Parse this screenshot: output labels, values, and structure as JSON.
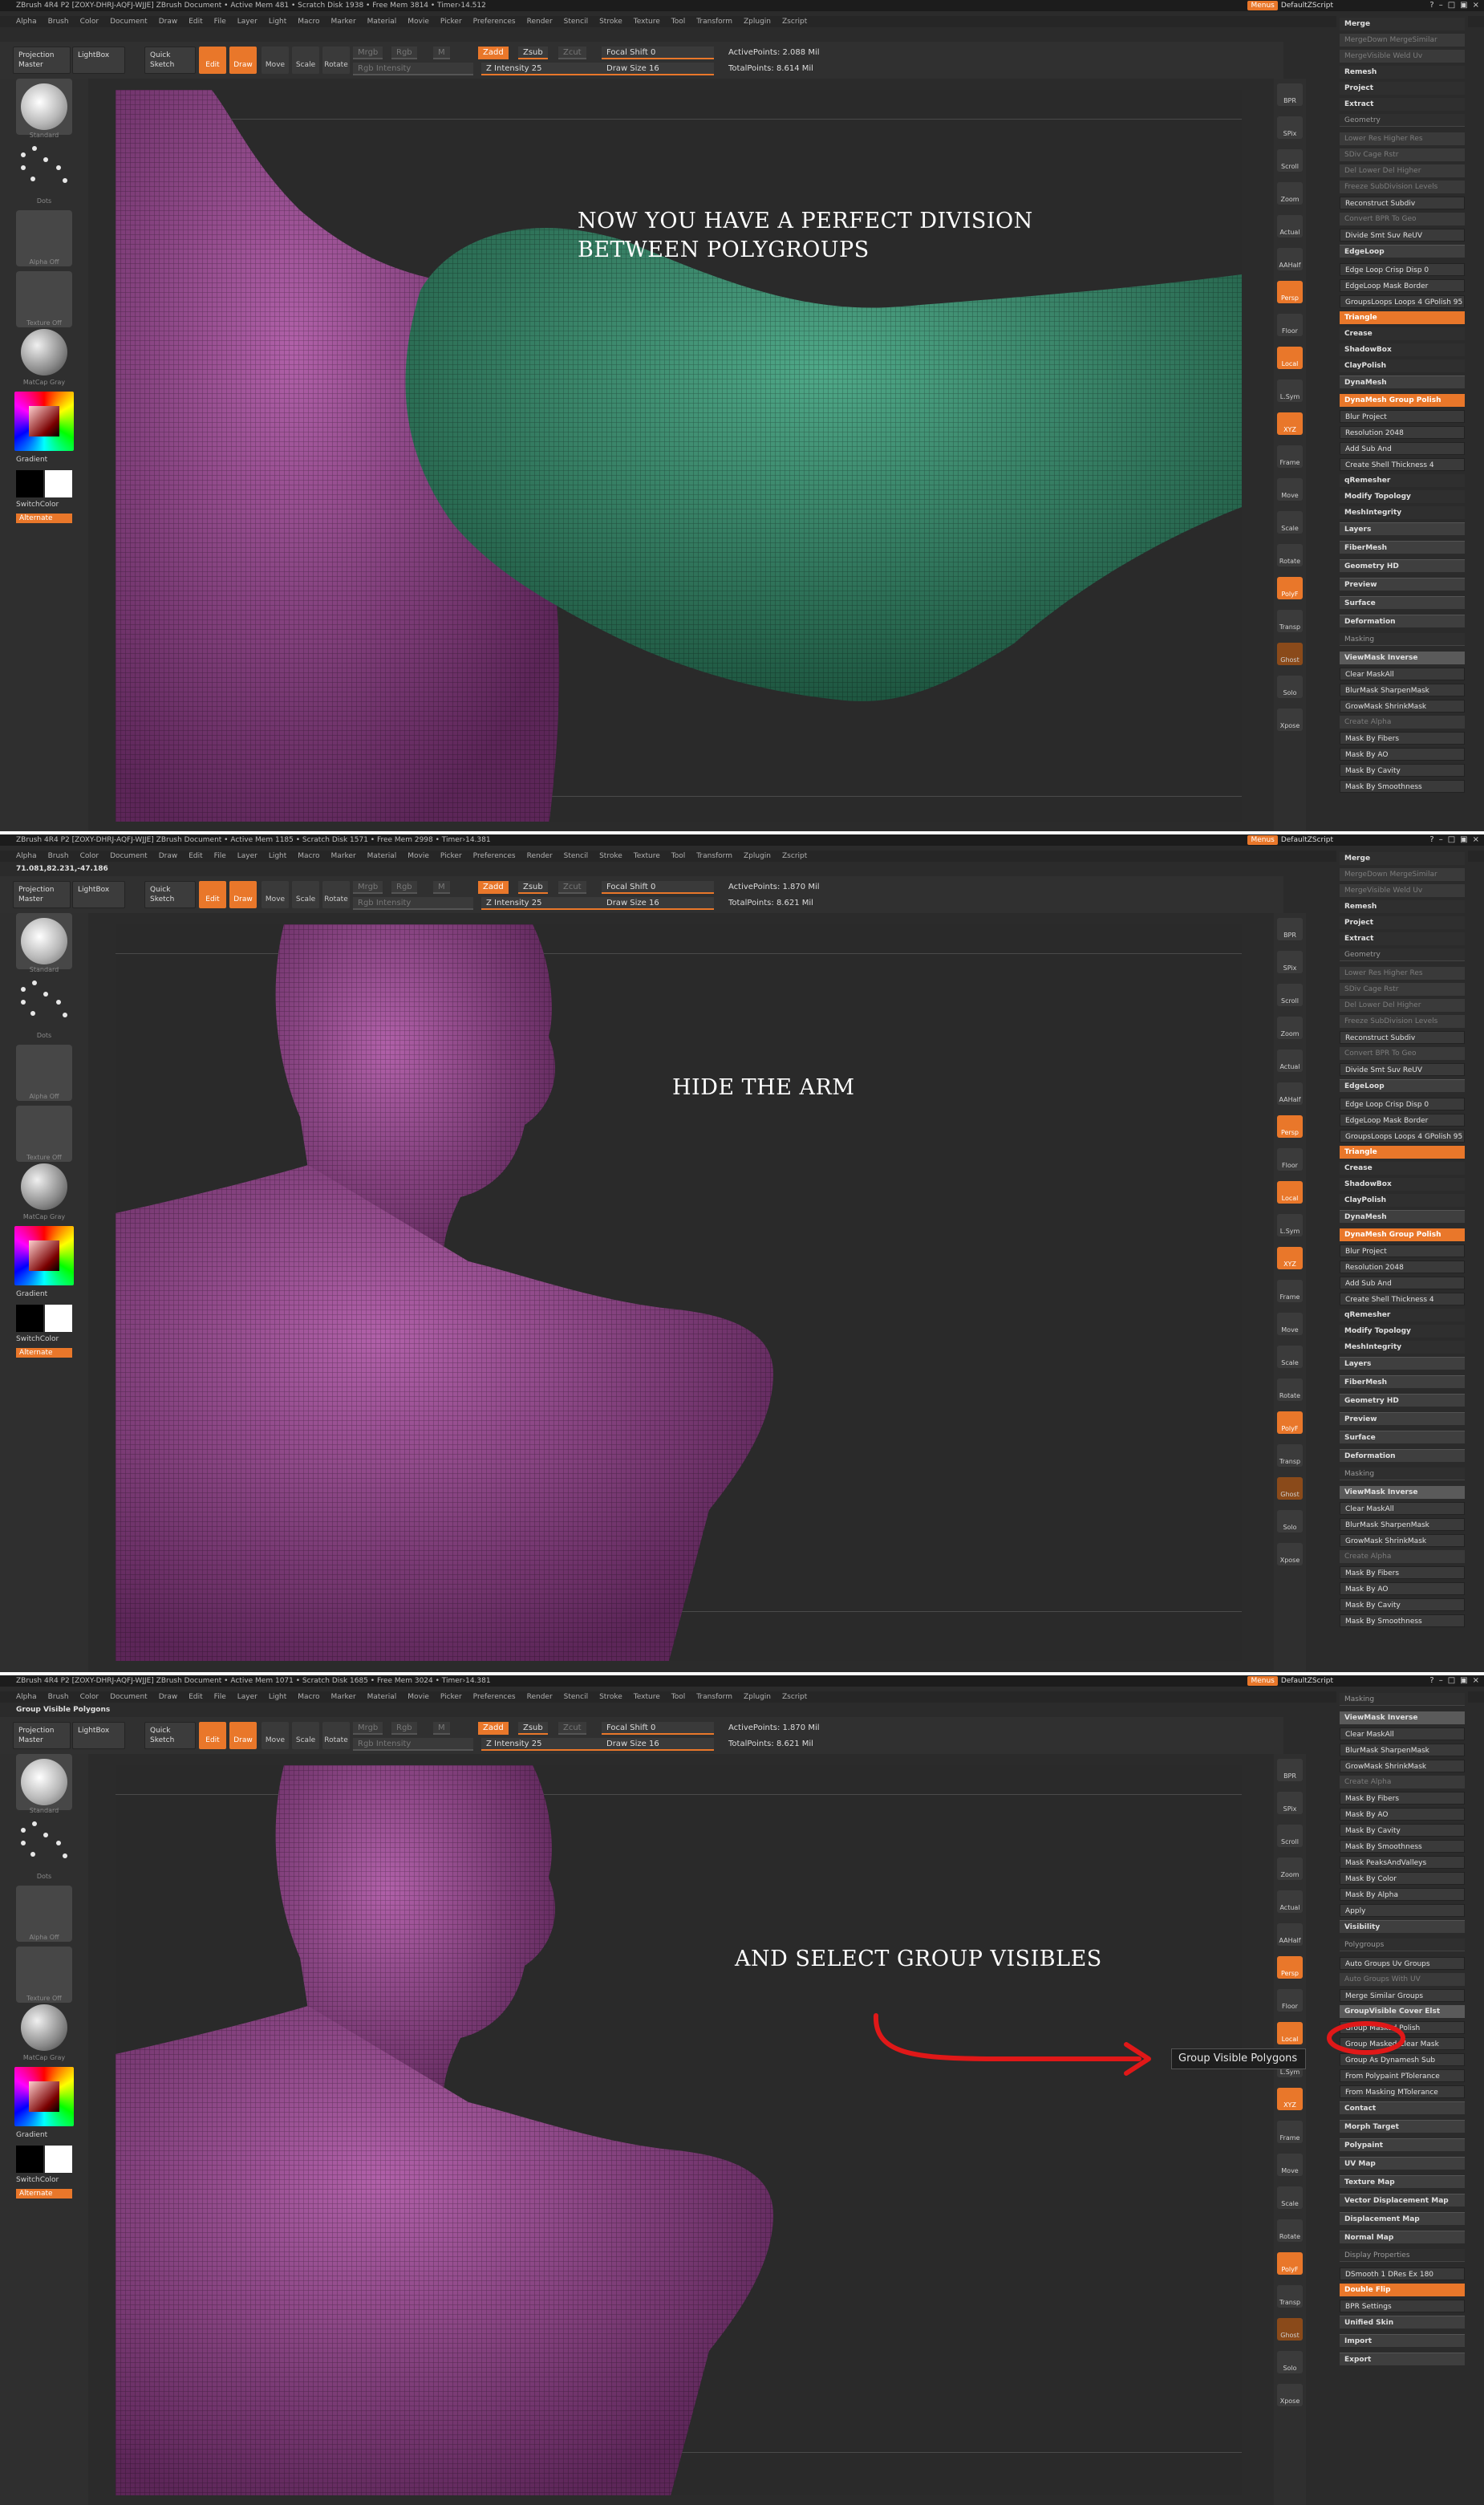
{
  "app": {
    "title_1": "ZBrush 4R4 P2 [ZOXY-DHRJ-AQFJ-WJJE]   ZBrush Document   • Active Mem 481 • Scratch Disk 1938 • Free Mem 3814 • Timer›14.512",
    "title_2": "ZBrush 4R4 P2 [ZOXY-DHRJ-AQFJ-WJJE]   ZBrush Document   • Active Mem 1185 • Scratch Disk 1571 • Free Mem 2998 • Timer›14.381",
    "title_3": "ZBrush 4R4 P2 [ZOXY-DHRJ-AQFJ-WJJE]   ZBrush Document   • Active Mem 1071 • Scratch Disk 1685 • Free Mem 3024 • Timer›14.381",
    "menus_btn": "Menus",
    "script": "DefaultZScript",
    "coords_2": "71.081,82.231,-47.186",
    "status_3": "Group Visible Polygons"
  },
  "menubar": [
    "Alpha",
    "Brush",
    "Color",
    "Document",
    "Draw",
    "Edit",
    "File",
    "Layer",
    "Light",
    "Macro",
    "Marker",
    "Material",
    "Movie",
    "Picker",
    "Preferences",
    "Render",
    "Stencil",
    "Stroke",
    "Texture",
    "Tool",
    "Transform",
    "Zplugin",
    "Zscript"
  ],
  "toolbar": {
    "projection_master": "Projection Master",
    "lightbox": "LightBox",
    "quick_sketch": "Quick Sketch",
    "edit": "Edit",
    "draw": "Draw",
    "move": "Move",
    "scale": "Scale",
    "rotate": "Rotate",
    "mrgb": "Mrgb",
    "rgb": "Rgb",
    "m": "M",
    "rgb_intensity": "Rgb Intensity",
    "zadd": "Zadd",
    "zsub": "Zsub",
    "zcut": "Zcut",
    "z_intensity": "Z Intensity 25",
    "focal_shift": "Focal Shift 0",
    "draw_size": "Draw Size 16",
    "active_points_1": "ActivePoints: 2.088 Mil",
    "total_points_1": "TotalPoints: 8.614 Mil",
    "active_points_2": "ActivePoints: 1.870 Mil",
    "total_points_2": "TotalPoints: 8.621 Mil",
    "active_points_3": "ActivePoints: 1.870 Mil",
    "total_points_3": "TotalPoints: 8.621 Mil"
  },
  "leftshelf": {
    "brush_label": "Standard",
    "stroke_label": "Dots",
    "alpha_label": "Alpha Off",
    "texture_label": "Texture Off",
    "material_label": "MatCap Gray",
    "gradient": "Gradient",
    "switch_color": "SwitchColor",
    "alternate": "Alternate"
  },
  "rightshelf": [
    "BPR",
    "SPix",
    "Scroll",
    "Zoom",
    "Actual",
    "AAHalf",
    "Persp",
    "Floor",
    "Local",
    "L.Sym",
    "XYZ",
    "Frame",
    "Move",
    "Scale",
    "Rotate",
    "PolyF",
    "Transp",
    "Ghost",
    "Solo",
    "Xpose"
  ],
  "overlays": {
    "caption_1_line1": "NOW YOU HAVE A PERFECT DIVISION",
    "caption_1_line2": "BETWEEN POLYGROUPS",
    "caption_2": "HIDE THE ARM",
    "caption_3": "AND SELECT GROUP VISIBLES"
  },
  "tooltip": "Group Visible Polygons",
  "rightpanel_a": [
    {
      "label": "Merge",
      "style": "plain"
    },
    {
      "label": "MergeDown   MergeSimilar",
      "style": "dim"
    },
    {
      "label": "MergeVisible   Weld   Uv",
      "style": "dim"
    },
    {
      "label": "Remesh",
      "style": "plain"
    },
    {
      "label": "Project",
      "style": "plain"
    },
    {
      "label": "Extract",
      "style": "plain"
    },
    {
      "label": "Geometry",
      "style": "head"
    },
    {
      "label": "Lower Res   Higher Res",
      "style": "dim"
    },
    {
      "label": "SDiv          Cage   Rstr",
      "style": "dim"
    },
    {
      "label": "Del Lower   Del Higher",
      "style": "dim"
    },
    {
      "label": "Freeze SubDivision Levels",
      "style": "dim"
    },
    {
      "label": "Reconstruct Subdiv",
      "style": "btn"
    },
    {
      "label": "Convert BPR To Geo",
      "style": "dim"
    },
    {
      "label": "Divide       Smt  Suv  ReUV",
      "style": "btn"
    },
    {
      "label": "EdgeLoop",
      "style": "sec"
    },
    {
      "label": "Edge Loop     Crisp  Disp 0",
      "style": "btn"
    },
    {
      "label": "EdgeLoop Mask Border",
      "style": "btn"
    },
    {
      "label": "GroupsLoops  Loops 4  GPolish 95",
      "style": "btn"
    },
    {
      "label": "Triangle",
      "style": "orange"
    },
    {
      "label": "Crease",
      "style": "plain"
    },
    {
      "label": "ShadowBox",
      "style": "plain"
    },
    {
      "label": "ClayPolish",
      "style": "plain"
    },
    {
      "label": "DynaMesh",
      "style": "sec"
    },
    {
      "label": "DynaMesh   Group  Polish",
      "style": "orange"
    },
    {
      "label": "Blur   Project",
      "style": "btn"
    },
    {
      "label": "Resolution 2048",
      "style": "btn"
    },
    {
      "label": "Add   Sub   And",
      "style": "btn"
    },
    {
      "label": "Create Shell   Thickness 4",
      "style": "btn"
    },
    {
      "label": "qRemesher",
      "style": "plain"
    },
    {
      "label": "Modify Topology",
      "style": "plain"
    },
    {
      "label": "MeshIntegrity",
      "style": "plain"
    },
    {
      "label": "Layers",
      "style": "sec"
    },
    {
      "label": "FiberMesh",
      "style": "sec"
    },
    {
      "label": "Geometry HD",
      "style": "sec"
    },
    {
      "label": "Preview",
      "style": "sec"
    },
    {
      "label": "Surface",
      "style": "sec"
    },
    {
      "label": "Deformation",
      "style": "sec"
    },
    {
      "label": "Masking",
      "style": "head"
    },
    {
      "label": "ViewMask   Inverse",
      "style": "hilite"
    },
    {
      "label": "Clear   MaskAll",
      "style": "btn"
    },
    {
      "label": "BlurMask   SharpenMask",
      "style": "btn"
    },
    {
      "label": "GrowMask   ShrinkMask",
      "style": "btn"
    },
    {
      "label": "Create Alpha",
      "style": "dim"
    },
    {
      "label": "Mask By Fibers",
      "style": "btn"
    },
    {
      "label": "Mask By AO",
      "style": "btn"
    },
    {
      "label": "Mask By Cavity",
      "style": "btn"
    },
    {
      "label": "Mask By Smoothness",
      "style": "btn"
    }
  ],
  "rightpanel_c": [
    {
      "label": "Masking",
      "style": "head"
    },
    {
      "label": "ViewMask   Inverse",
      "style": "hilite"
    },
    {
      "label": "Clear   MaskAll",
      "style": "btn"
    },
    {
      "label": "BlurMask   SharpenMask",
      "style": "btn"
    },
    {
      "label": "GrowMask   ShrinkMask",
      "style": "btn"
    },
    {
      "label": "Create Alpha",
      "style": "dim"
    },
    {
      "label": "Mask By Fibers",
      "style": "btn"
    },
    {
      "label": "Mask By AO",
      "style": "btn"
    },
    {
      "label": "Mask By Cavity",
      "style": "btn"
    },
    {
      "label": "Mask By Smoothness",
      "style": "btn"
    },
    {
      "label": "Mask PeaksAndValleys",
      "style": "btn"
    },
    {
      "label": "Mask By Color",
      "style": "btn"
    },
    {
      "label": "Mask By Alpha",
      "style": "btn"
    },
    {
      "label": "Apply",
      "style": "btn"
    },
    {
      "label": "Visibility",
      "style": "sec"
    },
    {
      "label": "Polygroups",
      "style": "head"
    },
    {
      "label": "Auto Groups   Uv Groups",
      "style": "btn"
    },
    {
      "label": "Auto Groups With UV",
      "style": "dim"
    },
    {
      "label": "Merge Similar Groups",
      "style": "btn"
    },
    {
      "label": "GroupVisible   Cover  Elst",
      "style": "hilite"
    },
    {
      "label": "Group Masked   Polish",
      "style": "btn"
    },
    {
      "label": "Group Masked Clear Mask",
      "style": "btn"
    },
    {
      "label": "Group As Dynamesh Sub",
      "style": "btn"
    },
    {
      "label": "From Polypaint   PTolerance",
      "style": "btn"
    },
    {
      "label": "From Masking   MTolerance",
      "style": "btn"
    },
    {
      "label": "Contact",
      "style": "sec"
    },
    {
      "label": "Morph Target",
      "style": "sec"
    },
    {
      "label": "Polypaint",
      "style": "sec"
    },
    {
      "label": "UV Map",
      "style": "sec"
    },
    {
      "label": "Texture Map",
      "style": "sec"
    },
    {
      "label": "Vector Displacement Map",
      "style": "sec"
    },
    {
      "label": "Displacement Map",
      "style": "sec"
    },
    {
      "label": "Normal Map",
      "style": "sec"
    },
    {
      "label": "Display Properties",
      "style": "head"
    },
    {
      "label": "DSmooth 1   DRes   Ex 180",
      "style": "btn"
    },
    {
      "label": "Double   Flip",
      "style": "orange"
    },
    {
      "label": "BPR Settings",
      "style": "btn"
    },
    {
      "label": "Unified Skin",
      "style": "sec"
    },
    {
      "label": "Import",
      "style": "sec"
    },
    {
      "label": "Export",
      "style": "sec"
    }
  ],
  "colors": {
    "accent": "#e9772a",
    "skin_purple": "#8a3f85",
    "arm_green": "#2f7a5e",
    "annotation_red": "#e01818"
  }
}
